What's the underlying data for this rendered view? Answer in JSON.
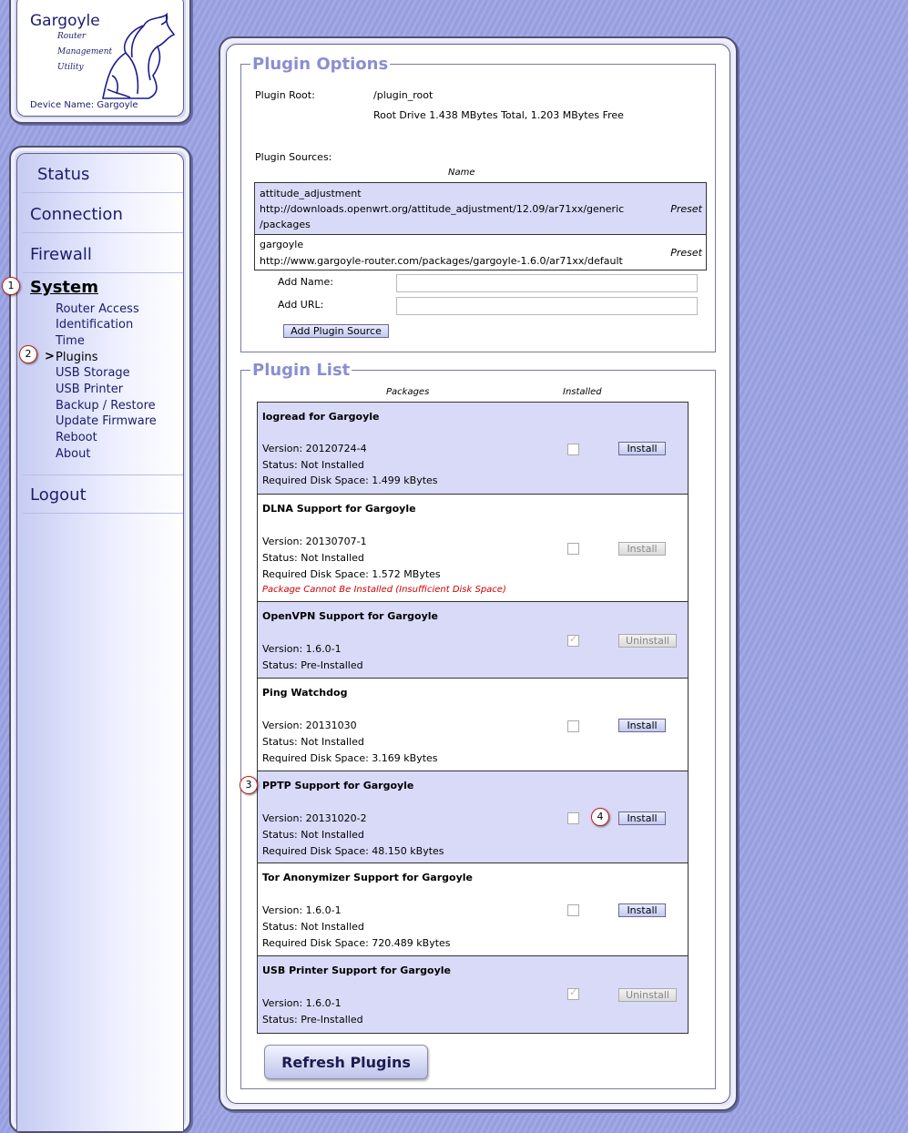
{
  "brand": {
    "title": "Gargoyle",
    "subtitle_lines": [
      "Router",
      "Management",
      "Utility"
    ],
    "device_name": "Device Name: Gargoyle"
  },
  "nav": {
    "main": [
      "Status",
      "Connection",
      "Firewall",
      "System",
      "Logout"
    ],
    "active": "System",
    "system_items": [
      "Router Access",
      "Identification",
      "Time",
      "Plugins",
      "USB Storage",
      "USB Printer",
      "Backup / Restore",
      "Update Firmware",
      "Reboot",
      "About"
    ],
    "current_item": "Plugins",
    "current_marker": ">"
  },
  "badges": [
    "1",
    "2",
    "3",
    "4"
  ],
  "plugin_options": {
    "legend": "Plugin Options",
    "root_label": "Plugin Root:",
    "root_value": "/plugin_root",
    "drive_info": "Root Drive 1.438 MBytes Total, 1.203 MBytes Free",
    "sources_label": "Plugin Sources:",
    "name_header": "Name",
    "sources": [
      {
        "name": "attitude_adjustment",
        "url_line1": "http://downloads.openwrt.org/attitude_adjustment/12.09/ar71xx/generic",
        "url_line2": "/packages",
        "tag": "Preset"
      },
      {
        "name": "gargoyle",
        "url_line1": "http://www.gargoyle-router.com/packages/gargoyle-1.6.0/ar71xx/default",
        "url_line2": "",
        "tag": "Preset"
      }
    ],
    "add_name_label": "Add Name:",
    "add_url_label": "Add URL:",
    "add_name_value": "",
    "add_url_value": "",
    "add_button": "Add Plugin Source"
  },
  "plugin_list": {
    "legend": "Plugin List",
    "col_packages": "Packages",
    "col_installed": "Installed",
    "plugins": [
      {
        "name": "logread for Gargoyle",
        "version": "Version: 20120724-4",
        "status": "Status: Not Installed",
        "disk": "Required Disk Space: 1.499 kBytes",
        "warning": "",
        "installed": false,
        "button": "Install",
        "button_enabled": true
      },
      {
        "name": "DLNA Support for Gargoyle",
        "version": "Version: 20130707-1",
        "status": "Status: Not Installed",
        "disk": "Required Disk Space: 1.572 MBytes",
        "warning": "Package Cannot Be Installed (Insufficient Disk Space)",
        "installed": false,
        "button": "Install",
        "button_enabled": false
      },
      {
        "name": "OpenVPN Support for Gargoyle",
        "version": "Version: 1.6.0-1",
        "status": "Status: Pre-Installed",
        "disk": "",
        "warning": "",
        "installed": true,
        "button": "Uninstall",
        "button_enabled": false
      },
      {
        "name": "Ping Watchdog",
        "version": "Version: 20131030",
        "status": "Status: Not Installed",
        "disk": "Required Disk Space: 3.169 kBytes",
        "warning": "",
        "installed": false,
        "button": "Install",
        "button_enabled": true
      },
      {
        "name": "PPTP Support for Gargoyle",
        "version": "Version: 20131020-2",
        "status": "Status: Not Installed",
        "disk": "Required Disk Space: 48.150 kBytes",
        "warning": "",
        "installed": false,
        "button": "Install",
        "button_enabled": true
      },
      {
        "name": "Tor Anonymizer Support for Gargoyle",
        "version": "Version: 1.6.0-1",
        "status": "Status: Not Installed",
        "disk": "Required Disk Space: 720.489 kBytes",
        "warning": "",
        "installed": false,
        "button": "Install",
        "button_enabled": true
      },
      {
        "name": "USB Printer Support for Gargoyle",
        "version": "Version: 1.6.0-1",
        "status": "Status: Pre-Installed",
        "disk": "",
        "warning": "",
        "installed": true,
        "button": "Uninstall",
        "button_enabled": false
      }
    ],
    "refresh_button": "Refresh Plugins"
  }
}
